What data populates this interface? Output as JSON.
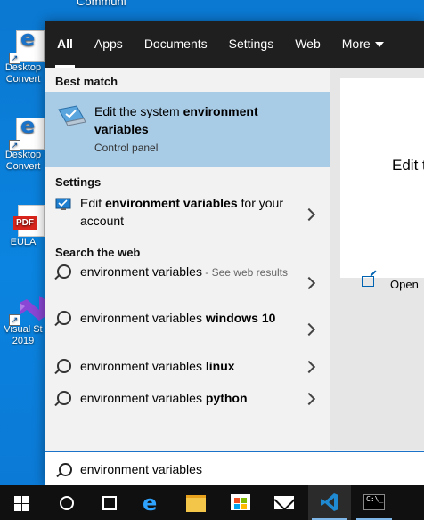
{
  "desktop": {
    "top_caption": "Communi",
    "icons": [
      {
        "label": "Desktop\nConvert",
        "kind": "edge-doc"
      },
      {
        "label": "Desktop\nConvert",
        "kind": "edge-doc"
      },
      {
        "label": "EULA",
        "kind": "pdf"
      },
      {
        "label": "Visual St\n2019",
        "kind": "visual-studio"
      }
    ],
    "pdf_badge": "PDF"
  },
  "search": {
    "tabs": [
      {
        "label": "All",
        "active": true
      },
      {
        "label": "Apps"
      },
      {
        "label": "Documents"
      },
      {
        "label": "Settings"
      },
      {
        "label": "Web"
      },
      {
        "label": "More"
      }
    ],
    "best_match": {
      "section_title": "Best match",
      "title_plain": "Edit the system ",
      "title_bold": "environment variables",
      "subtitle": "Control panel"
    },
    "settings": {
      "section_title": "Settings",
      "item": {
        "plain": "Edit ",
        "bold": "environment variables",
        "rest": " for your account"
      }
    },
    "web": {
      "section_title": "Search the web",
      "items": [
        {
          "plain": "environment variables",
          "bold": "",
          "suffix": " - See web results"
        },
        {
          "plain": "environment variables ",
          "bold": "windows 10",
          "suffix": ""
        },
        {
          "plain": "environment variables ",
          "bold": "linux",
          "suffix": ""
        },
        {
          "plain": "environment variables ",
          "bold": "python",
          "suffix": ""
        }
      ]
    },
    "preview": {
      "title": "Edit t",
      "open_label": "Open"
    },
    "query": "environment variables"
  },
  "taskbar": {
    "apps": [
      "windows-start",
      "cortana",
      "task-view",
      "edge",
      "file-explorer",
      "store",
      "mail",
      "vscode",
      "terminal"
    ],
    "terminal_text": "C:\\_"
  }
}
